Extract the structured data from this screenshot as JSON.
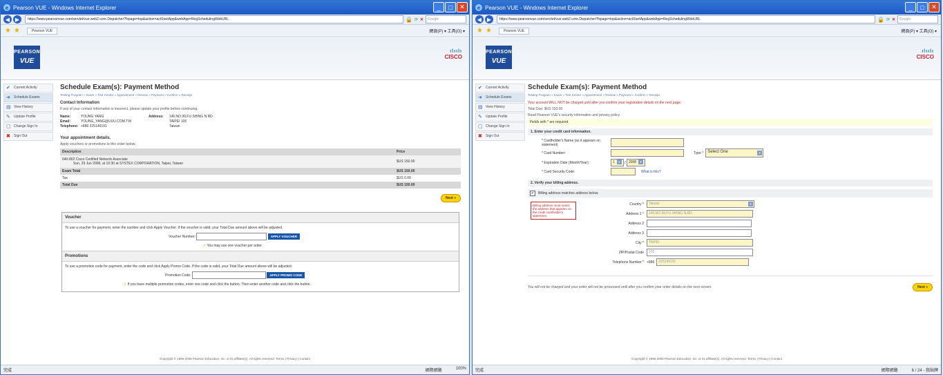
{
  "browser": {
    "title": "Pearson VUE - Windows Internet Explorer",
    "url": "https://www.pearsonvue.com/servlet/vue.web2.core.Dispatcher?fxpage=top&action=actStartApp&webApp=RegSchedulingWebURL",
    "search_placeholder": "Google",
    "tab_label": "Pearson VUE",
    "tools_label": "網頁(P) ▾  工具(O) ▾",
    "status_done": "完成",
    "status_zone": "網際網路",
    "status_zoom": "100%",
    "status_right_extra": "6 / 24 - 我貼牌"
  },
  "brand": {
    "pearson": "PEARSON",
    "vue": "VUE",
    "cisco": "CISCO"
  },
  "nav": [
    "Current Activity",
    "Schedule Exams",
    "View History",
    "Update Profile",
    "Change Sign In",
    "Sign Out"
  ],
  "left": {
    "title": "Schedule Exam(s): Payment Method",
    "crumbs": "Testing Program » Exam » Test Center » Appointment » Review » Payment » Confirm » Receipt",
    "contact_header": "Contact Information",
    "contact_text": "If any of your contact information is incorrect, please update your profile before continuing.",
    "name_label": "Name:",
    "name": "YOUNG YANG",
    "email_label": "Email:",
    "email": "YOUNG_YANG@UUU.COM.TW",
    "phone_label": "Telephone:",
    "phone": "+886 225149191",
    "address_label": "Address:",
    "address1": "14F,NO.99,FU SHING N.RD",
    "address2": "TAIPEI 105",
    "address3": "Taiwan",
    "appt_header": "Your appointment details.",
    "appt_sub": "Apply vouchers or promotions to this order below.",
    "col_desc": "Description",
    "col_price": "Price",
    "item_desc": "640-802   Cisco Certified Network Associate",
    "item_sub": "Sun, 29 Jun 2008, at 10:30 at SYSTEX CORPORATION, Taipei, Taiwan",
    "item_price": "$US 150.00",
    "exam_total_label": "Exam Total",
    "exam_total": "$US 150.00",
    "tax_label": "Tax",
    "tax": "$US 0.00",
    "total_label": "Total Due",
    "total": "$US 150.00",
    "next": "Next »",
    "voucher_header": "Voucher",
    "voucher_text": "To use a voucher for payment, enter the number and click Apply Voucher. If the voucher is valid, your Total Due amount above will be adjusted.",
    "voucher_label": "Voucher Number:",
    "voucher_btn": "APPLY VOUCHER",
    "voucher_note": "You may use one voucher per order.",
    "promo_header": "Promotions",
    "promo_text": "To use a promotion code for payment, enter the code and click Apply Promo Code. If the code is valid, your Total Due amount above will be adjusted.",
    "promo_label": "Promotion Code:",
    "promo_btn": "APPLY PROMO CODE",
    "promo_note": "If you have multiple promotion codes, enter one code and click the button. Then enter another code and click the button."
  },
  "right": {
    "title": "Schedule Exam(s): Payment Method",
    "crumbs": "Testing Program » Exam » Test Center » Appointment » Review » Payment » Confirm » Receipt",
    "warning": "Your account WILL NOT be charged until after you confirm your registration details on the next page.",
    "total_due": "Total Due: $US 150.00",
    "read_text": "Read Pearson VUE's security information and privacy policy.",
    "required": "Fields with * are required.",
    "step1": "1. Enter your credit card information.",
    "cardholder_label": "* Cardholder's Name (as it appears on statement)",
    "card_number_label": "* Card Number:",
    "type_label": "Type *",
    "type_value": "Select One",
    "exp_label": "* Expiration Date (Month/Year):",
    "exp_month": "1",
    "exp_year": "2008",
    "csc_label": "* Card Security Code:",
    "what_is_this": "What is this?",
    "step2": "2. Verify your billing address.",
    "billing_match": "Billing address matches address below.",
    "billing_warning": "Billing address must match the address that appears on the credit cardholder's statement.",
    "country_label": "Country *",
    "country": "Taiwan",
    "addr1_label": "Address 1 *",
    "addr1": "14F,NO.99,FU SHING N.RD",
    "addr2_label": "Address 2",
    "addr3_label": "Address 3",
    "city_label": "City *",
    "city": "TAIPEI",
    "zip_label": "ZIP/Postal Code",
    "zip": "105",
    "phone_label": "Telephone Number *",
    "phone_cc": "+886",
    "phone": "225149191",
    "bottom_note": "You will not be charged and your order will not be processed until after you confirm your order details on the next screen.",
    "next": "Next »"
  },
  "footer": "Copyright © 1996-2008 Pearson Education, Inc. or its affiliate(s). All rights reserved.  Terms | Privacy | Contact"
}
